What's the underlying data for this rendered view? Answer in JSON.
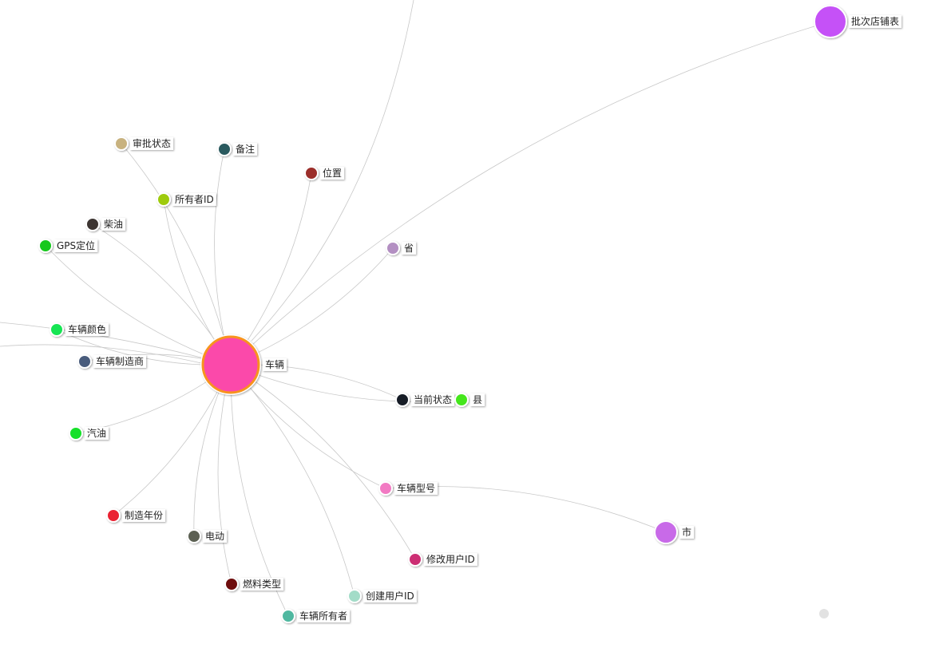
{
  "nodes": [
    {
      "id": "vehicle",
      "label": "车辆",
      "color": "#fb49aa",
      "ring": "#f7941d",
      "kind": "center"
    },
    {
      "id": "batch-store",
      "label": "批次店铺表",
      "color": "#c551f7",
      "kind": "large"
    },
    {
      "id": "city",
      "label": "市",
      "color": "#c86be8",
      "kind": "medium"
    },
    {
      "id": "approval-status",
      "label": "审批状态",
      "color": "#c8b27f"
    },
    {
      "id": "remark",
      "label": "备注",
      "color": "#2b5a5e"
    },
    {
      "id": "location",
      "label": "位置",
      "color": "#9b2e2a"
    },
    {
      "id": "owner-id",
      "label": "所有者ID",
      "color": "#9ecb0e"
    },
    {
      "id": "diesel",
      "label": "柴油",
      "color": "#3d3530"
    },
    {
      "id": "gps",
      "label": "GPS定位",
      "color": "#14c81e"
    },
    {
      "id": "province",
      "label": "省",
      "color": "#b38fc2"
    },
    {
      "id": "vehicle-color",
      "label": "车辆颜色",
      "color": "#18e553"
    },
    {
      "id": "manufacturer",
      "label": "车辆制造商",
      "color": "#4a5c7c"
    },
    {
      "id": "current-status",
      "label": "当前状态",
      "color": "#121a26"
    },
    {
      "id": "county",
      "label": "县",
      "color": "#45e61f"
    },
    {
      "id": "gasoline",
      "label": "汽油",
      "color": "#14e02a"
    },
    {
      "id": "vehicle-model",
      "label": "车辆型号",
      "color": "#f27ac3"
    },
    {
      "id": "build-year",
      "label": "制造年份",
      "color": "#ea2131"
    },
    {
      "id": "electric",
      "label": "电动",
      "color": "#5b6152"
    },
    {
      "id": "modifier-id",
      "label": "修改用户ID",
      "color": "#cc2f73"
    },
    {
      "id": "fuel-type",
      "label": "燃料类型",
      "color": "#6e0e0e"
    },
    {
      "id": "creator-id",
      "label": "创建用户ID",
      "color": "#a3dcc8"
    },
    {
      "id": "vehicle-owner",
      "label": "车辆所有者",
      "color": "#4fb8a0"
    },
    {
      "id": "faded",
      "label": "",
      "color": "#e2e2e2",
      "kind": "faded"
    }
  ],
  "edges": [
    [
      "vehicle",
      "batch-store"
    ],
    [
      "vehicle",
      "approval-status"
    ],
    [
      "vehicle",
      "remark"
    ],
    [
      "vehicle",
      "location"
    ],
    [
      "vehicle",
      "owner-id"
    ],
    [
      "vehicle",
      "diesel"
    ],
    [
      "vehicle",
      "gps"
    ],
    [
      "vehicle",
      "province"
    ],
    [
      "vehicle",
      "vehicle-color"
    ],
    [
      "vehicle",
      "manufacturer"
    ],
    [
      "vehicle",
      "current-status"
    ],
    [
      "vehicle",
      "county"
    ],
    [
      "vehicle",
      "gasoline"
    ],
    [
      "vehicle",
      "vehicle-model"
    ],
    [
      "vehicle",
      "build-year"
    ],
    [
      "vehicle",
      "electric"
    ],
    [
      "vehicle",
      "modifier-id"
    ],
    [
      "vehicle",
      "fuel-type"
    ],
    [
      "vehicle",
      "creator-id"
    ],
    [
      "vehicle",
      "vehicle-owner"
    ],
    [
      "vehicle-model",
      "city"
    ]
  ]
}
